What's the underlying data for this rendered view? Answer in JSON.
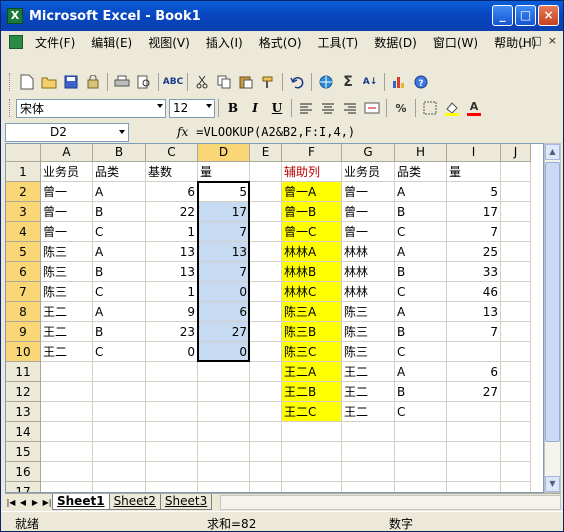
{
  "window": {
    "title": "Microsoft Excel - Book1",
    "icon": "excel-icon"
  },
  "title_buttons": {
    "min": "_",
    "max": "□",
    "close": "×"
  },
  "menu": [
    "文件(F)",
    "编辑(E)",
    "视图(V)",
    "插入(I)",
    "格式(O)",
    "工具(T)",
    "数据(D)",
    "窗口(W)",
    "帮助(H)"
  ],
  "mdi": {
    "min": "_",
    "restore": "□",
    "close": "×"
  },
  "toolbar1": [
    "new-icon",
    "open-icon",
    "save-icon",
    "permission-icon",
    "print-icon",
    "print-preview-icon",
    "spelling-icon",
    "cut-icon",
    "copy-icon",
    "paste-icon",
    "format-painter-icon",
    "undo-icon",
    "hyperlink-icon",
    "autosum-icon",
    "sort-icon",
    "chart-wizard-icon",
    "help-icon"
  ],
  "toolbar2": {
    "font": "宋体",
    "size": "12",
    "bold": "B",
    "italic": "I",
    "underline": "U",
    "align": [
      "align-left-icon",
      "align-center-icon",
      "align-right-icon",
      "merge-center-icon"
    ],
    "currency": "percent-icon",
    "border": "borders-icon",
    "fill": "fill-color-icon",
    "font_color": "A"
  },
  "formula_bar": {
    "name_box": "D2",
    "fx": "fx",
    "formula": "=VLOOKUP(A2&B2,F:I,4,)"
  },
  "columns": [
    "A",
    "B",
    "C",
    "D",
    "E",
    "F",
    "G",
    "H",
    "I",
    "J"
  ],
  "rows": [
    "1",
    "2",
    "3",
    "4",
    "5",
    "6",
    "7",
    "8",
    "9",
    "10",
    "11",
    "12",
    "13",
    "14",
    "15",
    "16",
    "17"
  ],
  "cells": {
    "A": [
      "业务员",
      "曾一",
      "曾一",
      "曾一",
      "陈三",
      "陈三",
      "陈三",
      "王二",
      "王二",
      "王二",
      "",
      "",
      "",
      "",
      "",
      "",
      ""
    ],
    "B": [
      "品类",
      "A",
      "B",
      "C",
      "A",
      "B",
      "C",
      "A",
      "B",
      "C",
      "",
      "",
      "",
      "",
      "",
      "",
      ""
    ],
    "C": [
      "基数",
      "6",
      "22",
      "1",
      "13",
      "13",
      "1",
      "9",
      "23",
      "0",
      "",
      "",
      "",
      "",
      "",
      "",
      ""
    ],
    "D": [
      "量",
      "5",
      "17",
      "7",
      "13",
      "7",
      "0",
      "6",
      "27",
      "0",
      "",
      "",
      "",
      "",
      "",
      "",
      ""
    ],
    "E": [
      "",
      "",
      "",
      "",
      "",
      "",
      "",
      "",
      "",
      "",
      "",
      "",
      "",
      "",
      "",
      "",
      ""
    ],
    "F": [
      "辅助列",
      "曾一A",
      "曾一B",
      "曾一C",
      "林林A",
      "林林B",
      "林林C",
      "陈三A",
      "陈三B",
      "陈三C",
      "王二A",
      "王二B",
      "王二C",
      "",
      "",
      "",
      ""
    ],
    "G": [
      "业务员",
      "曾一",
      "曾一",
      "曾一",
      "林林",
      "林林",
      "林林",
      "陈三",
      "陈三",
      "陈三",
      "王二",
      "王二",
      "王二",
      "",
      "",
      "",
      ""
    ],
    "H": [
      "品类",
      "A",
      "B",
      "C",
      "A",
      "B",
      "C",
      "A",
      "B",
      "C",
      "A",
      "B",
      "C",
      "",
      "",
      "",
      ""
    ],
    "I": [
      "量",
      "5",
      "17",
      "7",
      "25",
      "33",
      "46",
      "13",
      "7",
      "",
      "6",
      "27",
      "",
      "",
      "",
      "",
      ""
    ],
    "J": [
      "",
      "",
      "",
      "",
      "",
      "",
      "",
      "",
      "",
      "",
      "",
      "",
      "",
      "",
      "",
      "",
      ""
    ]
  },
  "sheets": [
    "Sheet1",
    "Sheet2",
    "Sheet3"
  ],
  "status": {
    "ready": "就绪",
    "sum": "求和=82",
    "mode": "数字"
  },
  "colors": {
    "highlight_yellow": "#ffff00",
    "selection_blue": "#c6dbf1",
    "header_red": "#c00000",
    "title_blue": "#0a5fd9"
  }
}
